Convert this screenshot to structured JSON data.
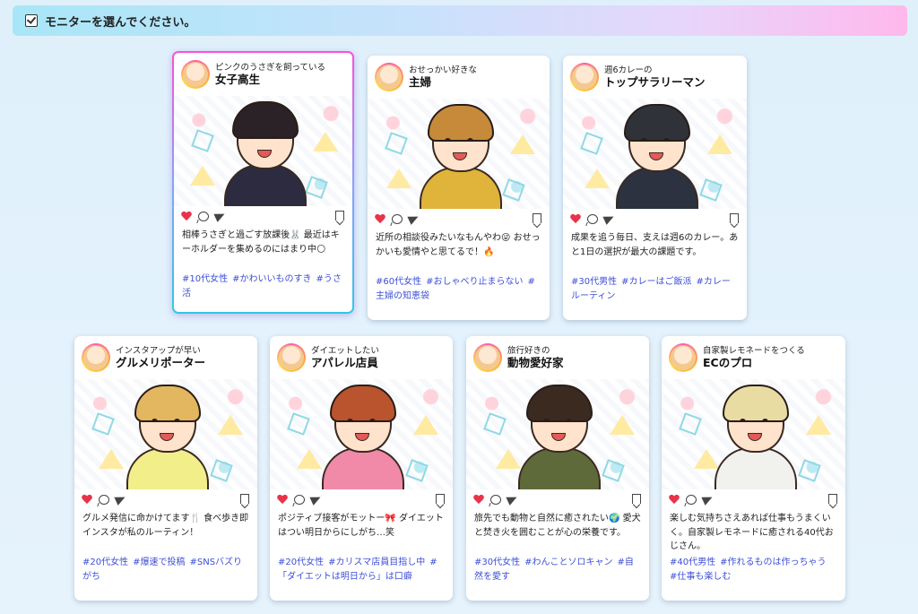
{
  "header": {
    "title": "モニターを選んでください。"
  },
  "cards": [
    {
      "sub": "ピンクのうさぎを飼っている",
      "name": "女子高生",
      "desc": "相棒うさぎと過ごす放課後🐰 最近はキーホルダーを集めるのにはまり中🌕",
      "tags": [
        "#10代女性",
        "#かわいいものすき",
        "#うさ活"
      ],
      "selected": true,
      "hair": "#2b2228",
      "outfit": "#2d2b40"
    },
    {
      "sub": "おせっかい好きな",
      "name": "主婦",
      "desc": "近所の相談役みたいなもんやわ😜 おせっかいも愛情やと思てるで！🔥",
      "tags": [
        "#60代女性",
        "#おしゃべり止まらない",
        "#主婦の知恵袋"
      ],
      "selected": false,
      "hair": "#c68a3a",
      "outfit": "#e0b43a"
    },
    {
      "sub": "週6カレーの",
      "name": "トップサラリーマン",
      "desc": "成果を追う毎日、支えは週6のカレー。あと1日の選択が最大の課題です。",
      "tags": [
        "#30代男性",
        "#カレーはご飯派",
        "#カレールーティン"
      ],
      "selected": false,
      "hair": "#2f3238",
      "outfit": "#2c3240"
    },
    {
      "sub": "インスタアップが早い",
      "name": "グルメリポーター",
      "desc": "グルメ発信に命かけてます🍴 食べ歩き即インスタが私のルーティン！",
      "tags": [
        "#20代女性",
        "#爆速で投稿",
        "#SNSバズりがち"
      ],
      "selected": false,
      "hair": "#e2b760",
      "outfit": "#f2ee8a"
    },
    {
      "sub": "ダイエットしたい",
      "name": "アパレル店員",
      "desc": "ポジティブ接客がモットー🎀 ダイエットはつい明日からにしがち…笑",
      "tags": [
        "#20代女性",
        "#カリスマ店員目指し中",
        "#「ダイエットは明日から」は口癖"
      ],
      "selected": false,
      "hair": "#b9542e",
      "outfit": "#f08aa8"
    },
    {
      "sub": "旅行好きの",
      "name": "動物愛好家",
      "desc": "旅先でも動物と自然に癒されたい🌍 愛犬と焚き火を囲むことが心の栄養です。",
      "tags": [
        "#30代女性",
        "#わんことソロキャン",
        "#自然を愛す"
      ],
      "selected": false,
      "hair": "#3a2a20",
      "outfit": "#5f6a3a"
    },
    {
      "sub": "自家製レモネードをつくる",
      "name": "ECのプロ",
      "desc": "楽しむ気持ちさえあれば仕事もうまくいく。自家製レモネードに癒される40代おじさん。",
      "tags": [
        "#40代男性",
        "#作れるものは作っちゃう",
        "#仕事も楽しむ"
      ],
      "selected": false,
      "hair": "#e9dca2",
      "outfit": "#f1f1ee"
    }
  ]
}
